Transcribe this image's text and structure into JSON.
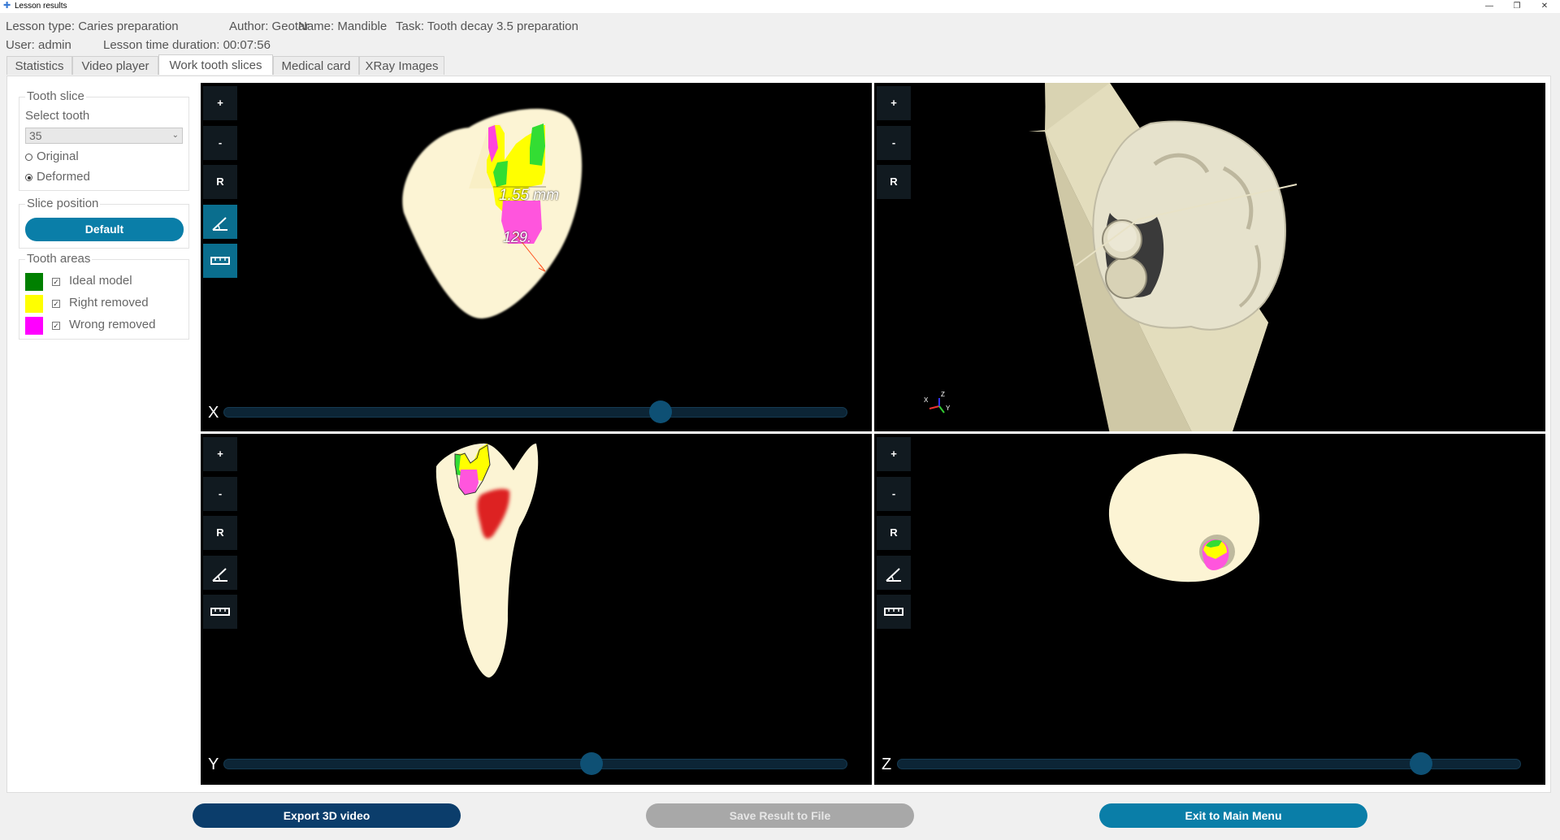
{
  "window": {
    "title": "Lesson results",
    "minimize": "—",
    "restore": "❐",
    "close": "✕"
  },
  "header": {
    "lesson_type": "Lesson type: Caries preparation",
    "author": "Author: Geotar",
    "name": "Name: Mandible",
    "task": "Task: Tooth decay 3.5 preparation",
    "user": "User: admin",
    "duration": "Lesson time duration: 00:07:56"
  },
  "tabs": [
    {
      "label": "Statistics"
    },
    {
      "label": "Video player"
    },
    {
      "label": "Work tooth slices",
      "active": true
    },
    {
      "label": "Medical card"
    },
    {
      "label": "XRay Images"
    }
  ],
  "tooth_slice": {
    "title": "Tooth slice",
    "select_label": "Select tooth",
    "selected_tooth": "35",
    "options": [
      {
        "label": "Original",
        "checked": false
      },
      {
        "label": "Deformed",
        "checked": true
      }
    ]
  },
  "slice_position": {
    "title": "Slice position",
    "default_button": "Default"
  },
  "tooth_areas": {
    "title": "Tooth areas",
    "items": [
      {
        "label": "Ideal model",
        "color": "#008000",
        "checked": true
      },
      {
        "label": "Right removed",
        "color": "#ffff00",
        "checked": true
      },
      {
        "label": "Wrong removed",
        "color": "#ff00ff",
        "checked": true
      }
    ]
  },
  "viewports": {
    "tools": {
      "zoom_in": "+",
      "zoom_out": "-",
      "reset": "R",
      "angle": "angle-icon",
      "ruler": "ruler-icon"
    },
    "x": {
      "axis": "X",
      "slider": 0.7,
      "measure_length": "1.55  mm",
      "measure_angle": "129."
    },
    "y": {
      "axis": "Y",
      "slider": 0.59
    },
    "z": {
      "axis": "Z",
      "slider": 0.84
    },
    "view3d": {
      "axes": {
        "x": "X",
        "y": "Y",
        "z": "Z"
      }
    }
  },
  "bottom": {
    "export": "Export 3D video",
    "save": "Save Result to File",
    "exit": "Exit to Main Menu"
  },
  "colors": {
    "accent": "#0a7ea8",
    "dark_accent": "#0b3d6b",
    "disabled": "#a8a8a8",
    "tooth": "#fcf4d4",
    "pulp": "#dd2222"
  }
}
